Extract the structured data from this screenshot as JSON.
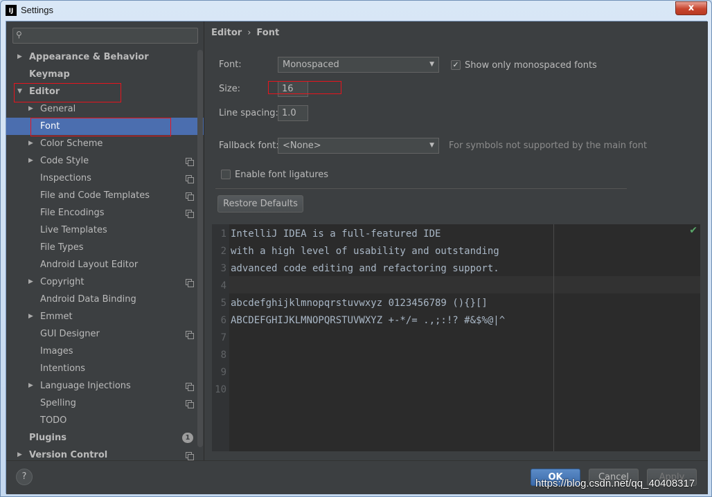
{
  "window": {
    "title": "Settings",
    "app_icon": "IJ",
    "close_label": "x"
  },
  "search": {
    "placeholder": "",
    "value": ""
  },
  "sidebar": {
    "items": [
      {
        "label": "Appearance & Behavior",
        "expandable": true,
        "expanded": false,
        "bold": true
      },
      {
        "label": "Keymap",
        "bold": true
      },
      {
        "label": "Editor",
        "expandable": true,
        "expanded": true,
        "bold": true
      },
      {
        "label": "General",
        "expandable": true,
        "expanded": false
      },
      {
        "label": "Font",
        "selected": true
      },
      {
        "label": "Color Scheme",
        "expandable": true,
        "expanded": false
      },
      {
        "label": "Code Style",
        "expandable": true,
        "expanded": false,
        "project_icon": true
      },
      {
        "label": "Inspections",
        "project_icon": true
      },
      {
        "label": "File and Code Templates",
        "project_icon": true
      },
      {
        "label": "File Encodings",
        "project_icon": true
      },
      {
        "label": "Live Templates"
      },
      {
        "label": "File Types"
      },
      {
        "label": "Android Layout Editor"
      },
      {
        "label": "Copyright",
        "expandable": true,
        "expanded": false,
        "project_icon": true
      },
      {
        "label": "Android Data Binding"
      },
      {
        "label": "Emmet",
        "expandable": true,
        "expanded": false
      },
      {
        "label": "GUI Designer",
        "project_icon": true
      },
      {
        "label": "Images"
      },
      {
        "label": "Intentions"
      },
      {
        "label": "Language Injections",
        "expandable": true,
        "expanded": false,
        "project_icon": true
      },
      {
        "label": "Spelling",
        "project_icon": true
      },
      {
        "label": "TODO"
      },
      {
        "label": "Plugins",
        "bold": true,
        "badge": "1"
      },
      {
        "label": "Version Control",
        "expandable": true,
        "expanded": false,
        "bold": true,
        "project_icon": true
      }
    ]
  },
  "breadcrumb": {
    "parent": "Editor",
    "separator": "›",
    "current": "Font"
  },
  "font_settings": {
    "font_label": "Font:",
    "font_value": "Monospaced",
    "show_monospaced_label": "Show only monospaced fonts",
    "show_monospaced_checked": true,
    "size_label": "Size:",
    "size_value": "16",
    "line_spacing_label": "Line spacing:",
    "line_spacing_value": "1.0",
    "fallback_label": "Fallback font:",
    "fallback_value": "<None>",
    "fallback_hint": "For symbols not supported by the main font",
    "ligatures_label": "Enable font ligatures",
    "ligatures_checked": false,
    "restore_label": "Restore Defaults"
  },
  "preview": {
    "line_numbers": [
      "1",
      "2",
      "3",
      "4",
      "5",
      "6",
      "7",
      "8",
      "9",
      "10"
    ],
    "lines": [
      "IntelliJ IDEA is a full-featured IDE",
      "with a high level of usability and outstanding",
      "advanced code editing and refactoring support.",
      "",
      "abcdefghijklmnopqrstuvwxyz 0123456789 (){}[]",
      "ABCDEFGHIJKLMNOPQRSTUVWXYZ +-*/= .,;:!? #&$%@|^",
      "",
      "",
      "",
      ""
    ]
  },
  "buttons": {
    "help": "?",
    "ok": "OK",
    "cancel": "Cancel",
    "apply": "Apply"
  },
  "watermark": "https://blog.csdn.net/qq_40408317",
  "colors": {
    "accent": "#4b6eaf",
    "highlight_box": "#e8141d",
    "background": "#3c3f41",
    "editor_bg": "#2b2b2b"
  }
}
